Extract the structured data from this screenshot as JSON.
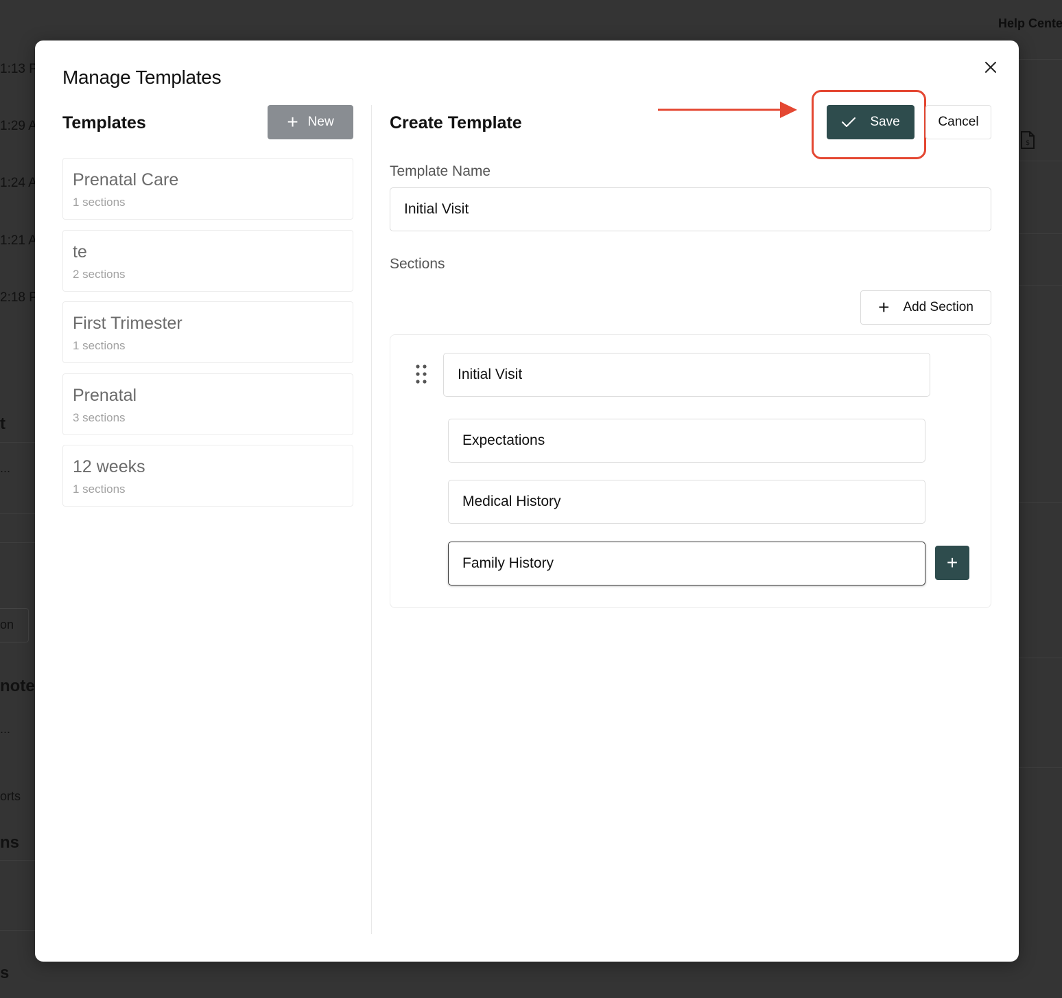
{
  "background": {
    "help_center": "Help Cente",
    "times": [
      "1:13 P",
      "1:29 A",
      "1:24 A",
      "1:21 A",
      "2:18 P"
    ],
    "fragments": [
      "t",
      "...",
      "on",
      "notes",
      "...",
      "orts",
      "ns",
      "s"
    ]
  },
  "modal": {
    "title": "Manage Templates"
  },
  "templates_pane": {
    "title": "Templates",
    "new_label": "New",
    "items": [
      {
        "name": "Prenatal Care",
        "count": "1 sections"
      },
      {
        "name": "te",
        "count": "2 sections"
      },
      {
        "name": "First Trimester",
        "count": "1 sections"
      },
      {
        "name": "Prenatal",
        "count": "3 sections"
      },
      {
        "name": "12 weeks",
        "count": "1 sections"
      }
    ]
  },
  "editor": {
    "title": "Create Template",
    "save_label": "Save",
    "cancel_label": "Cancel",
    "template_name_label": "Template Name",
    "template_name_value": "Initial Visit",
    "sections_label": "Sections",
    "add_section_label": "Add Section",
    "section": {
      "title": "Initial Visit",
      "items": [
        "Expectations",
        "Medical History",
        "Family History"
      ]
    }
  },
  "colors": {
    "primary": "#2e4c4d",
    "highlight": "#e44732",
    "new_button": "#898d92"
  }
}
